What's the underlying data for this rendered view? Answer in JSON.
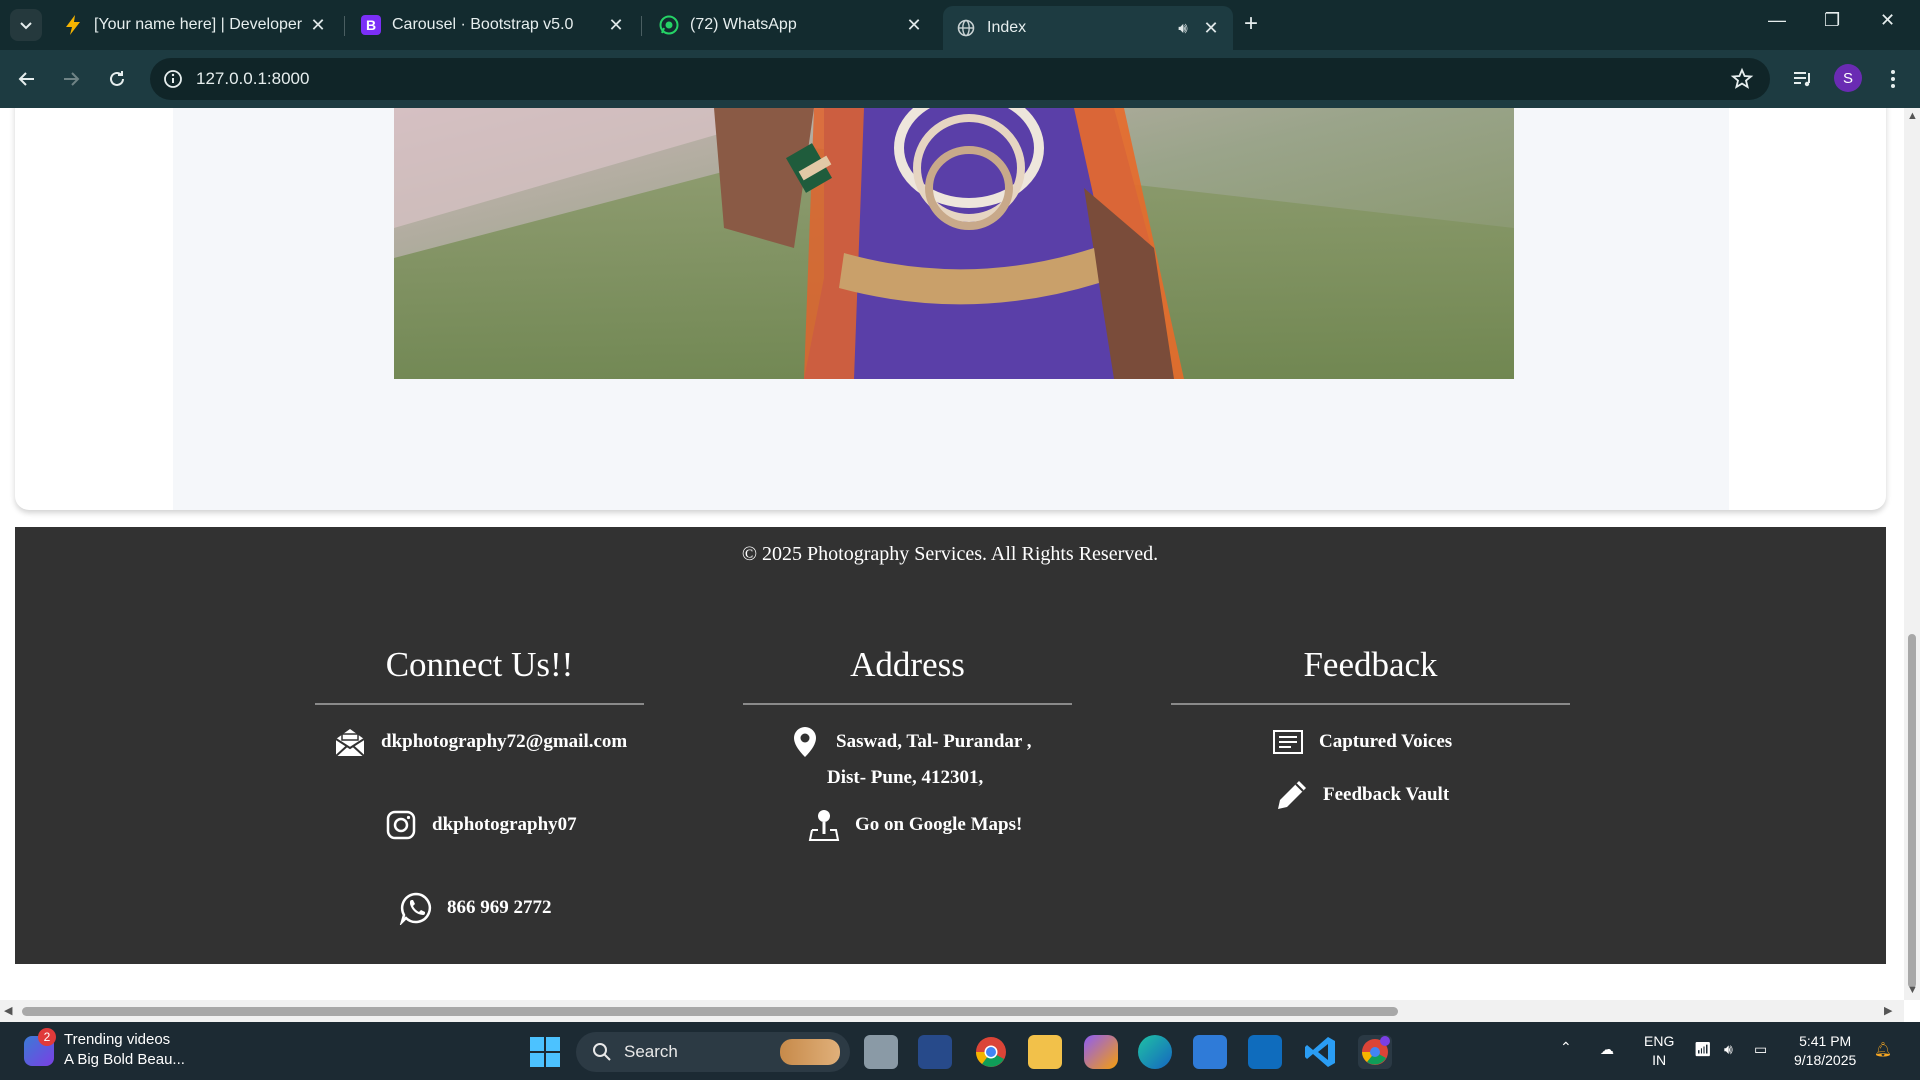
{
  "browser": {
    "tabs": [
      {
        "title": "[Your name here] | Developer",
        "icon": "bolt-icon"
      },
      {
        "title": "Carousel · Bootstrap v5.0",
        "icon": "bootstrap-icon"
      },
      {
        "title": "(72) WhatsApp",
        "icon": "whatsapp-icon"
      },
      {
        "title": "Index",
        "icon": "globe-icon",
        "active": true
      }
    ],
    "url": "127.0.0.1:8000",
    "profile_initial": "S"
  },
  "footer": {
    "copyright": "© 2025 Photography Services. All Rights Reserved.",
    "connect": {
      "heading": "Connect Us!!",
      "email": "dkphotography72@gmail.com",
      "instagram": "dkphotography07",
      "phone": "866 969 2772"
    },
    "address": {
      "heading": "Address",
      "line1": "Saswad, Tal- Purandar ,",
      "line2": "Dist- Pune, 412301,",
      "maps_link": "Go on Google Maps!"
    },
    "feedback": {
      "heading": "Feedback",
      "captured_voices": "Captured Voices",
      "feedback_vault": "Feedback Vault"
    }
  },
  "taskbar": {
    "widget_title": "Trending videos",
    "widget_subtitle": "A Big Bold Beau...",
    "widget_badge": "2",
    "search_placeholder": "Search",
    "language": "ENG",
    "region": "IN",
    "time": "5:41 PM",
    "date": "9/18/2025"
  },
  "colors": {
    "footer_bg": "#323232",
    "chrome_bg": "#132b2f",
    "toolbar_bg": "#1d3b41"
  }
}
